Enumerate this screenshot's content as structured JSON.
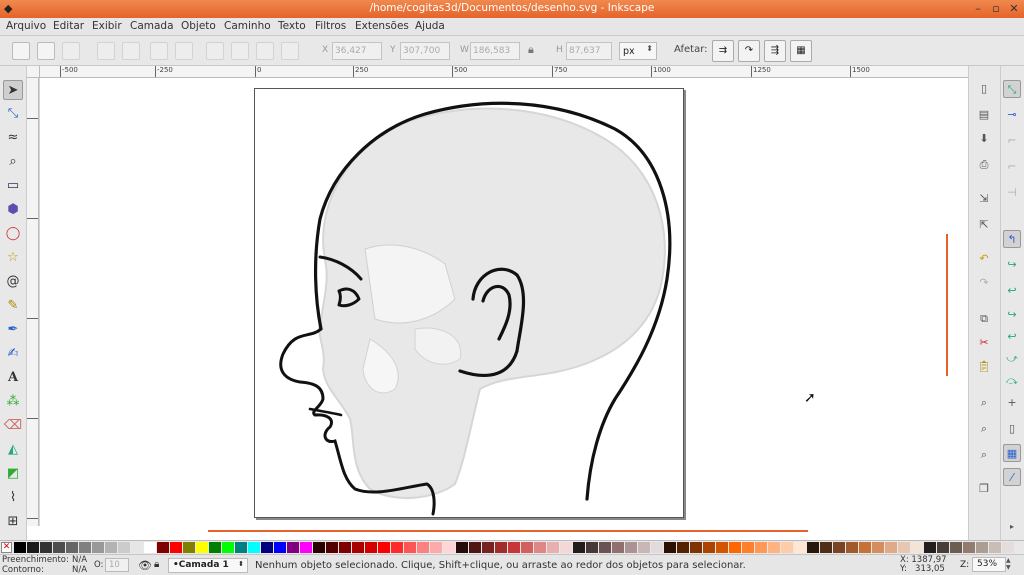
{
  "window": {
    "title": "/home/cogitas3d/Documentos/desenho.svg - Inkscape"
  },
  "menu": [
    "Arquivo",
    "Editar",
    "Exibir",
    "Camada",
    "Objeto",
    "Caminho",
    "Texto",
    "Filtros",
    "Extensões",
    "Ajuda"
  ],
  "controls": {
    "x_label": "X",
    "x_value": "36,427",
    "y_label": "Y",
    "y_value": "307,700",
    "w_label": "W",
    "w_value": "186,583",
    "h_label": "H",
    "h_value": "87,637",
    "unit": "px",
    "afetar_label": "Afetar:"
  },
  "ruler": {
    "h_ticks": [
      "-500",
      "-250",
      "0",
      "250",
      "500",
      "750",
      "1000",
      "1250",
      "1500"
    ]
  },
  "palette": {
    "none_glyph": "✕",
    "swatches": [
      "#000000",
      "#1a1a1a",
      "#333333",
      "#4d4d4d",
      "#666666",
      "#808080",
      "#999999",
      "#b3b3b3",
      "#cccccc",
      "#e6e6e6",
      "#ffffff",
      "#800000",
      "#ff0000",
      "#808000",
      "#ffff00",
      "#008000",
      "#00ff00",
      "#008080",
      "#00ffff",
      "#000080",
      "#0000ff",
      "#800080",
      "#ff00ff",
      "#2b0000",
      "#550000",
      "#800000",
      "#aa0000",
      "#d40000",
      "#ff0000",
      "#ff2a2a",
      "#ff5555",
      "#ff8080",
      "#ffaaaa",
      "#ffd5d5",
      "#280b0b",
      "#501616",
      "#782121",
      "#a02c2c",
      "#c83737",
      "#d35f5f",
      "#de8787",
      "#e9afaf",
      "#f4d7d7",
      "#241c1c",
      "#483737",
      "#6c5353",
      "#916f6f",
      "#ac9393",
      "#c8b7b7",
      "#e3dbdb",
      "#2b1100",
      "#552200",
      "#803300",
      "#aa4400",
      "#d45500",
      "#ff6600",
      "#ff7f2a",
      "#ff9955",
      "#ffb380",
      "#ffccaa",
      "#ffe6d5",
      "#28170b",
      "#502d16",
      "#784421",
      "#a05a2c",
      "#c87137",
      "#d38d5f",
      "#deaa87",
      "#e9c6af",
      "#f4e3d7",
      "#241f1c",
      "#483e37",
      "#6c5d53",
      "#917c6f",
      "#ac9d93",
      "#c8beb7",
      "#e3dedb",
      "#2b2200",
      "#554400",
      "#806600",
      "#aa8800",
      "#d4aa00"
    ]
  },
  "status": {
    "fill_label": "Preenchimento:",
    "fill_value": "N/A",
    "stroke_label": "Contorno:",
    "stroke_value": "N/A",
    "opacity_label": "O:",
    "opacity_value": "10",
    "layer": "•Camada 1",
    "message": "Nenhum objeto selecionado. Clique, Shift+clique, ou arraste ao redor dos objetos para selecionar.",
    "x_coord": "X: 1387,97",
    "y_coord": "Y:   313,05",
    "zoom_label": "Z:",
    "zoom_value": "53%"
  }
}
